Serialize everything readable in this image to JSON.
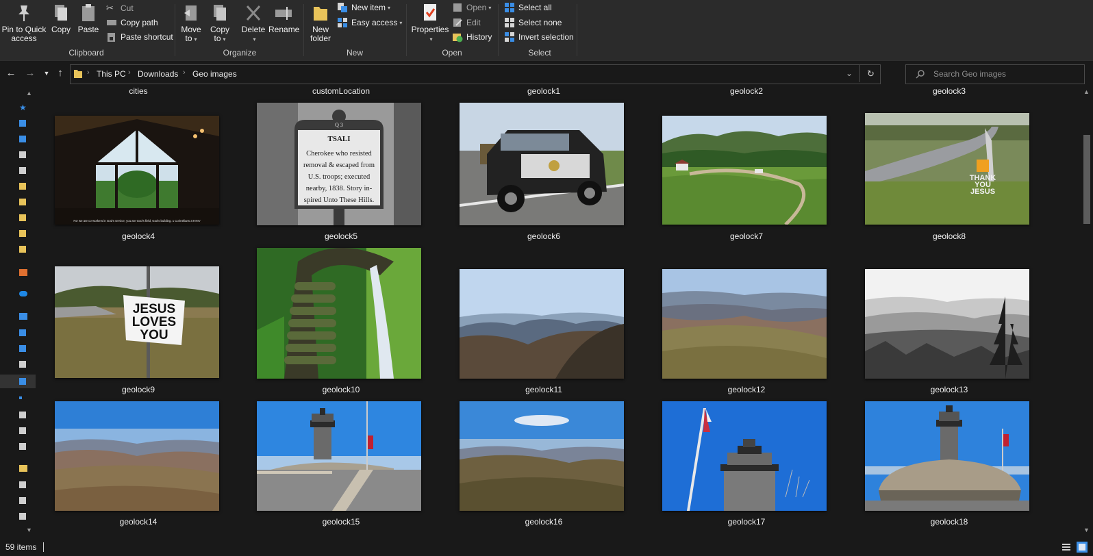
{
  "ribbon": {
    "clipboard": {
      "group_label": "Clipboard",
      "pin_label_1": "Pin to Quick",
      "pin_label_2": "access",
      "copy_label": "Copy",
      "paste_label": "Paste",
      "cut_label": "Cut",
      "copy_path_label": "Copy path",
      "paste_shortcut_label": "Paste shortcut"
    },
    "organize": {
      "group_label": "Organize",
      "move_label_1": "Move",
      "move_label_2": "to",
      "copy_label_1": "Copy",
      "copy_label_2": "to",
      "delete_label": "Delete",
      "rename_label": "Rename"
    },
    "new": {
      "group_label": "New",
      "new_folder_label_1": "New",
      "new_folder_label_2": "folder",
      "new_item_label": "New item",
      "easy_access_label": "Easy access"
    },
    "open": {
      "group_label": "Open",
      "properties_label": "Properties",
      "open_label": "Open",
      "edit_label": "Edit",
      "history_label": "History"
    },
    "select": {
      "group_label": "Select",
      "select_all_label": "Select all",
      "select_none_label": "Select none",
      "invert_label": "Invert selection"
    }
  },
  "address": {
    "crumbs": [
      "This PC",
      "Downloads",
      "Geo images"
    ]
  },
  "search": {
    "placeholder": "Search Geo images"
  },
  "top_row_captions": [
    "cities",
    "customLocation",
    "geolock1",
    "geolock2",
    "geolock3"
  ],
  "items": [
    {
      "name": "geolock4"
    },
    {
      "name": "geolock5"
    },
    {
      "name": "geolock6"
    },
    {
      "name": "geolock7"
    },
    {
      "name": "geolock8"
    },
    {
      "name": "geolock9"
    },
    {
      "name": "geolock10"
    },
    {
      "name": "geolock11"
    },
    {
      "name": "geolock12"
    },
    {
      "name": "geolock13"
    },
    {
      "name": "geolock14"
    },
    {
      "name": "geolock15"
    },
    {
      "name": "geolock16"
    },
    {
      "name": "geolock17"
    },
    {
      "name": "geolock18"
    }
  ],
  "thumb_text": {
    "geolock4_caption": "For we are co-workers in God's service; you are God's field, God's building. 1 Corinthians 3:9 NIV",
    "geolock5_title": "TSALI",
    "geolock5_lines": [
      "Cherokee who resisted",
      "removal & escaped from",
      "U.S. troops; executed",
      "nearby, 1838. Story in-",
      "spired Unto These Hills."
    ],
    "geolock5_number": "Q 3",
    "geolock8_sign": [
      "THANK",
      "YOU",
      "JESUS"
    ],
    "geolock9_sign": [
      "JESUS",
      "LOVES",
      "YOU"
    ]
  },
  "status": {
    "count": "59 items"
  },
  "colors": {
    "background": "#191919",
    "ribbon": "#2b2b2b",
    "folder_yellow": "#e8c35a",
    "accent_blue": "#3a8ee6"
  }
}
